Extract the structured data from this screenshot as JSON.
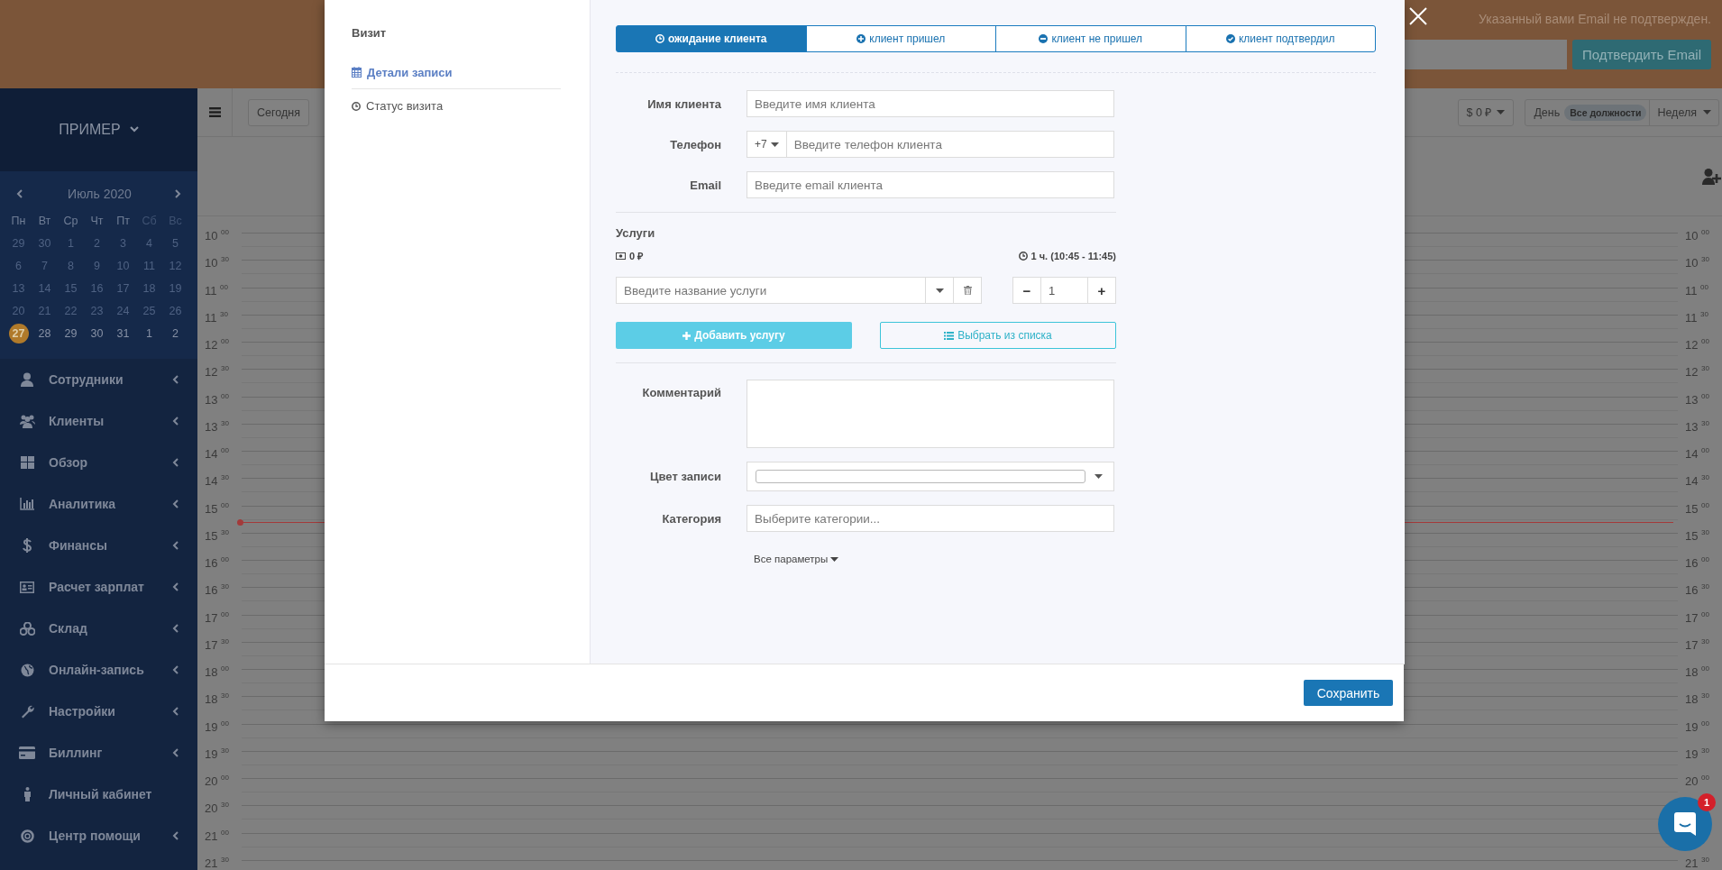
{
  "banner": {
    "message": "Указанный вами Email не подтвержден.",
    "confirm_button": "Подтвердить Email"
  },
  "sidebar": {
    "brand": "ПРИМЕР",
    "calendar": {
      "month": "Июль 2020",
      "weekdays": [
        {
          "label": "Пн",
          "weekend": false
        },
        {
          "label": "Вт",
          "weekend": false
        },
        {
          "label": "Ср",
          "weekend": false
        },
        {
          "label": "Чт",
          "weekend": false
        },
        {
          "label": "Пт",
          "weekend": false
        },
        {
          "label": "Сб",
          "weekend": true
        },
        {
          "label": "Вс",
          "weekend": true
        }
      ],
      "days": [
        {
          "label": "29",
          "muted": true,
          "selected": false
        },
        {
          "label": "30",
          "muted": true,
          "selected": false
        },
        {
          "label": "1",
          "muted": true,
          "selected": false
        },
        {
          "label": "2",
          "muted": true,
          "selected": false
        },
        {
          "label": "3",
          "muted": true,
          "selected": false
        },
        {
          "label": "4",
          "muted": true,
          "selected": false
        },
        {
          "label": "5",
          "muted": true,
          "selected": false
        },
        {
          "label": "6",
          "muted": true,
          "selected": false
        },
        {
          "label": "7",
          "muted": true,
          "selected": false
        },
        {
          "label": "8",
          "muted": true,
          "selected": false
        },
        {
          "label": "9",
          "muted": true,
          "selected": false
        },
        {
          "label": "10",
          "muted": true,
          "selected": false
        },
        {
          "label": "11",
          "muted": true,
          "selected": false
        },
        {
          "label": "12",
          "muted": true,
          "selected": false
        },
        {
          "label": "13",
          "muted": true,
          "selected": false
        },
        {
          "label": "14",
          "muted": true,
          "selected": false
        },
        {
          "label": "15",
          "muted": true,
          "selected": false
        },
        {
          "label": "16",
          "muted": true,
          "selected": false
        },
        {
          "label": "17",
          "muted": true,
          "selected": false
        },
        {
          "label": "18",
          "muted": true,
          "selected": false
        },
        {
          "label": "19",
          "muted": true,
          "selected": false
        },
        {
          "label": "20",
          "muted": true,
          "selected": false
        },
        {
          "label": "21",
          "muted": true,
          "selected": false
        },
        {
          "label": "22",
          "muted": true,
          "selected": false
        },
        {
          "label": "23",
          "muted": true,
          "selected": false
        },
        {
          "label": "24",
          "muted": true,
          "selected": false
        },
        {
          "label": "25",
          "muted": true,
          "selected": false
        },
        {
          "label": "26",
          "muted": true,
          "selected": false
        },
        {
          "label": "27",
          "muted": false,
          "selected": true
        },
        {
          "label": "28",
          "muted": false,
          "selected": false
        },
        {
          "label": "29",
          "muted": false,
          "selected": false
        },
        {
          "label": "30",
          "muted": false,
          "selected": false
        },
        {
          "label": "31",
          "muted": false,
          "selected": false
        },
        {
          "label": "1",
          "muted": false,
          "selected": false
        },
        {
          "label": "2",
          "muted": false,
          "selected": false
        }
      ]
    },
    "menu": [
      {
        "label": "Сотрудники",
        "expandable": true
      },
      {
        "label": "Клиенты",
        "expandable": true
      },
      {
        "label": "Обзор",
        "expandable": true
      },
      {
        "label": "Аналитика",
        "expandable": true
      },
      {
        "label": "Финансы",
        "expandable": true
      },
      {
        "label": "Расчет зарплат",
        "expandable": true
      },
      {
        "label": "Склад",
        "expandable": true
      },
      {
        "label": "Онлайн-запись",
        "expandable": true
      },
      {
        "label": "Настройки",
        "expandable": true
      },
      {
        "label": "Биллинг",
        "expandable": true
      },
      {
        "label": "Личный кабинет",
        "expandable": false
      },
      {
        "label": "Центр помощи",
        "expandable": true
      }
    ]
  },
  "toolbar": {
    "today_button": "Сегодня",
    "balance_button": "$ 0 ₽",
    "day_button": "День",
    "positions_badge": "Все должности",
    "week_button": "Неделя"
  },
  "timeline": {
    "left_times": [
      "10 $^{00}$",
      "10 $^{30}$",
      "11 $^{00}$",
      "11 $^{30}$",
      "12 $^{00}$",
      "12 $^{30}$",
      "13 $^{00}$",
      "13 $^{30}$",
      "14 $^{00}$",
      "14 $^{30}$",
      "15 $^{00}$",
      "15 $^{30}$",
      "16 $^{00}$",
      "16 $^{30}$",
      "17 $^{00}$",
      "17 $^{30}$",
      "18 $^{00}$",
      "18 $^{30}$",
      "19 $^{00}$",
      "19 $^{30}$",
      "20 $^{00}$",
      "20 $^{30}$",
      "21 $^{00}$",
      "21 $^{30}$"
    ],
    "right_times": [
      "10 $^{00}$",
      "10 $^{30}$",
      "11 $^{00}$",
      "11 $^{30}$",
      "12 $^{00}$",
      "12 $^{30}$",
      "13 $^{00}$",
      "13 $^{30}$",
      "14 $^{00}$",
      "14 $^{30}$",
      "15 $^{00}$",
      "15 $^{30}$",
      "16 $^{00}$",
      "16 $^{30}$",
      "17 $^{00}$",
      "17 $^{30}$",
      "18 $^{00}$",
      "18 $^{30}$",
      "19 $^{00}$",
      "19 $^{30}$",
      "20 $^{00}$"
    ],
    "right_bottom": "21 $^{30}$"
  },
  "modal": {
    "nav_title": "Визит",
    "nav": [
      {
        "label": "Детали записи",
        "selected": true
      },
      {
        "label": "Статус визита",
        "selected": false
      }
    ],
    "status_tabs": [
      {
        "label": "ожидание клиента",
        "selected": true
      },
      {
        "label": "клиент пришел",
        "selected": false
      },
      {
        "label": "клиент не пришел",
        "selected": false
      },
      {
        "label": "клиент подтвердил",
        "selected": false
      }
    ],
    "client_name": {
      "label": "Имя клиента",
      "placeholder": "Введите имя клиента"
    },
    "phone": {
      "label": "Телефон",
      "code": "+7",
      "placeholder": "Введите телефон клиента"
    },
    "email": {
      "label": "Email",
      "placeholder": "Введите email клиента"
    },
    "services": {
      "title": "Услуги",
      "price": "0 ₽",
      "duration": "1 ч. (10:45 - 11:45)",
      "service_placeholder": "Введите название услуги",
      "quantity": "1",
      "decrease": "−",
      "increase": "+",
      "add_button": "Добавить услугу",
      "pick_button": "Выбрать из списка"
    },
    "comment": {
      "label": "Комментарий"
    },
    "color": {
      "label": "Цвет записи"
    },
    "category": {
      "label": "Категория",
      "placeholder": "Выберите категории..."
    },
    "more_link": "Все параметры",
    "save_button": "Сохранить"
  },
  "chat": {
    "badge": "1"
  }
}
